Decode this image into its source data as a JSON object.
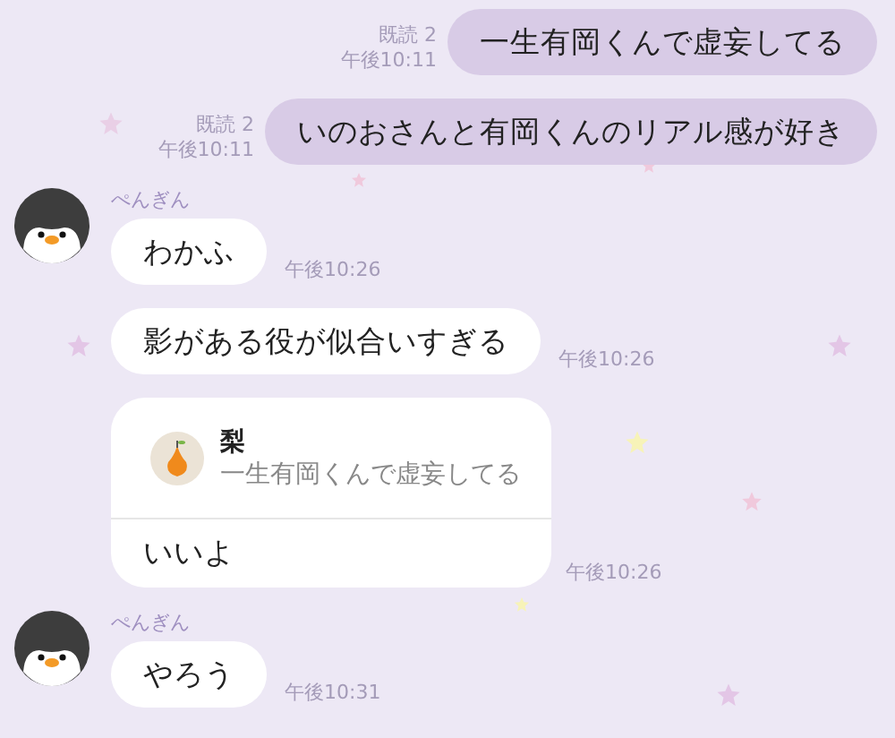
{
  "messages": [
    {
      "kind": "sent",
      "read": "既読 2",
      "time": "午後10:11",
      "text": "一生有岡くんで虚妄してる"
    },
    {
      "kind": "sent",
      "read": "既読 2",
      "time": "午後10:11",
      "text": "いのおさんと有岡くんのリアル感が好き"
    },
    {
      "kind": "received",
      "sender": "ぺんぎん",
      "text": "わかふ",
      "time": "午後10:26"
    },
    {
      "kind": "received",
      "text": "影がある役が似合いすぎる",
      "time": "午後10:26"
    },
    {
      "kind": "reply",
      "quote_sender": "梨",
      "quote_text": "一生有岡くんで虚妄してる",
      "text": "いいよ",
      "time": "午後10:26"
    },
    {
      "kind": "received",
      "sender": "ぺんぎん",
      "text": "やろう",
      "time": "午後10:31"
    }
  ]
}
